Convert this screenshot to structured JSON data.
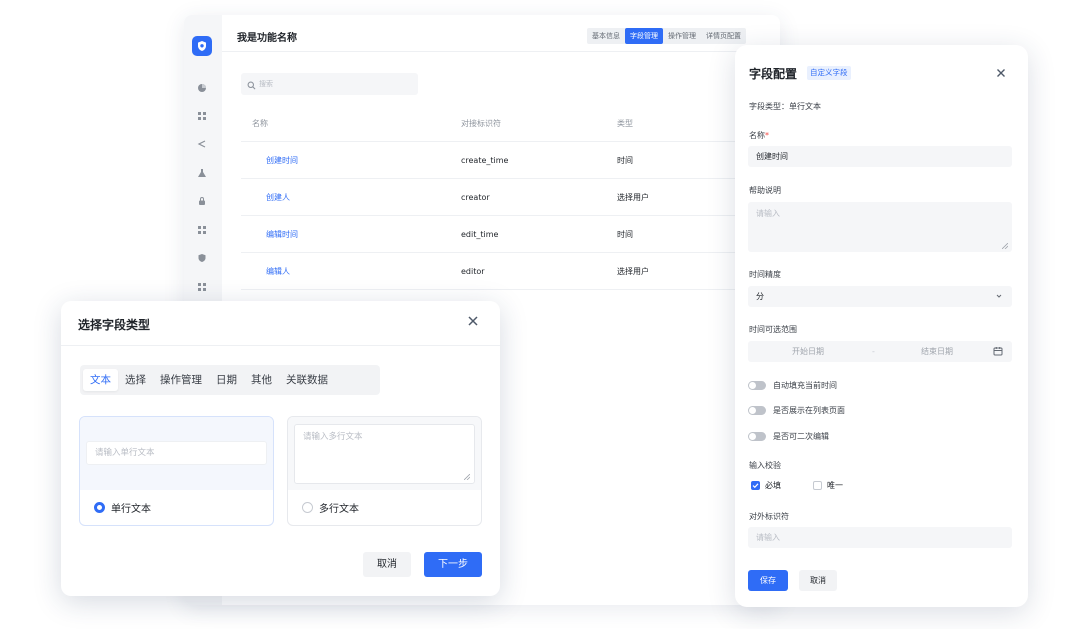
{
  "app": {
    "title": "我是功能名称",
    "tabs": [
      "基本信息",
      "字段管理",
      "操作管理",
      "详情页配置"
    ],
    "active_tab": "字段管理",
    "search_placeholder": "搜索",
    "rail_icons": [
      "pie-chart-icon",
      "grid-icon",
      "share-icon",
      "flask-icon",
      "lock-icon",
      "apps-icon",
      "shield-icon",
      "apps-icon"
    ],
    "table": {
      "headers": [
        "名称",
        "对接标识符",
        "类型"
      ],
      "rows": [
        [
          "创建时间",
          "create_time",
          "时间"
        ],
        [
          "创建人",
          "creator",
          "选择用户"
        ],
        [
          "编辑时间",
          "edit_time",
          "时间"
        ],
        [
          "编辑人",
          "editor",
          "选择用户"
        ]
      ]
    }
  },
  "type_dialog": {
    "title": "选择字段类型",
    "tabs": [
      "文本",
      "选择",
      "操作管理",
      "日期",
      "其他",
      "关联数据"
    ],
    "active_tab": "文本",
    "options": [
      {
        "label": "单行文本",
        "placeholder": "请输入单行文本",
        "selected": true
      },
      {
        "label": "多行文本",
        "placeholder": "请输入多行文本",
        "selected": false
      }
    ],
    "cancel_label": "取消",
    "next_label": "下一步"
  },
  "config_panel": {
    "title": "字段配置",
    "badge": "自定义字段",
    "field_type_label": "字段类型：单行文本",
    "name_label": "名称",
    "required_mark": "*",
    "name_value": "创建时间",
    "help_label": "帮助说明",
    "help_placeholder": "请输入",
    "precision_label": "时间精度",
    "precision_value": "分",
    "range_label": "时间可选范围",
    "range_start": "开始日期",
    "range_sep": "-",
    "range_end": "结束日期",
    "toggles": [
      "自动填充当前时间",
      "是否展示在列表页面",
      "是否可二次编辑"
    ],
    "validation_label": "输入校验",
    "checks": [
      {
        "label": "必填",
        "checked": true
      },
      {
        "label": "唯一",
        "checked": false
      }
    ],
    "external_id_label": "对外标识符",
    "external_id_placeholder": "请输入",
    "save_label": "保存",
    "cancel_label": "取消"
  },
  "colors": {
    "accent": "#2f6cf6",
    "required": "#f54a45"
  }
}
